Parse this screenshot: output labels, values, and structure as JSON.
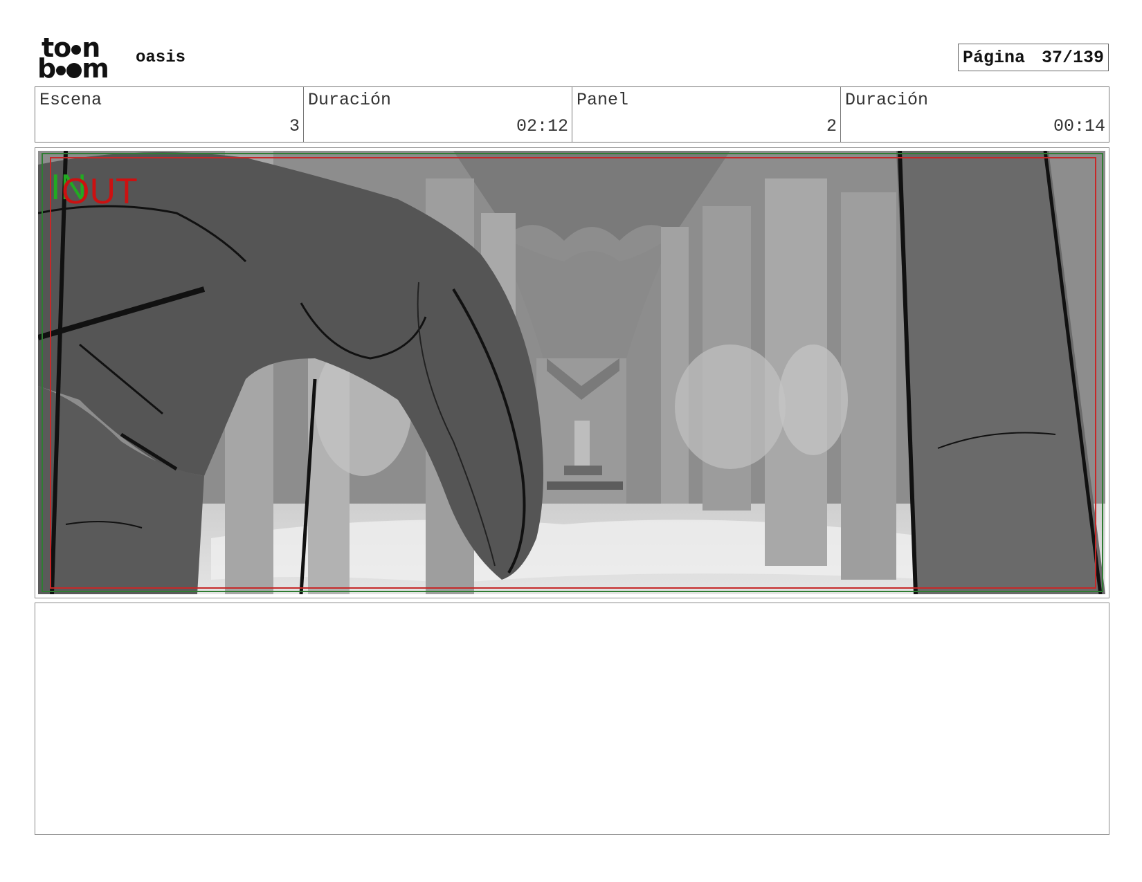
{
  "header": {
    "logo_top": "to",
    "logo_top_end": "n",
    "logo_bottom": "b",
    "logo_bottom_end": "m",
    "project": "oasis",
    "page_label": "Página",
    "page_value": "37/139"
  },
  "info": {
    "scene_label": "Escena",
    "scene_value": "3",
    "scene_duration_label": "Duración",
    "scene_duration_value": "02:12",
    "panel_label": "Panel",
    "panel_value": "2",
    "panel_duration_label": "Duración",
    "panel_duration_value": "00:14"
  },
  "panel": {
    "in_marker": "IN",
    "out_marker": "OUT"
  },
  "colors": {
    "in_marker": "#22aa22",
    "out_marker": "#cc1111",
    "frame_red": "#c62828",
    "frame_green": "#2e7d32"
  }
}
